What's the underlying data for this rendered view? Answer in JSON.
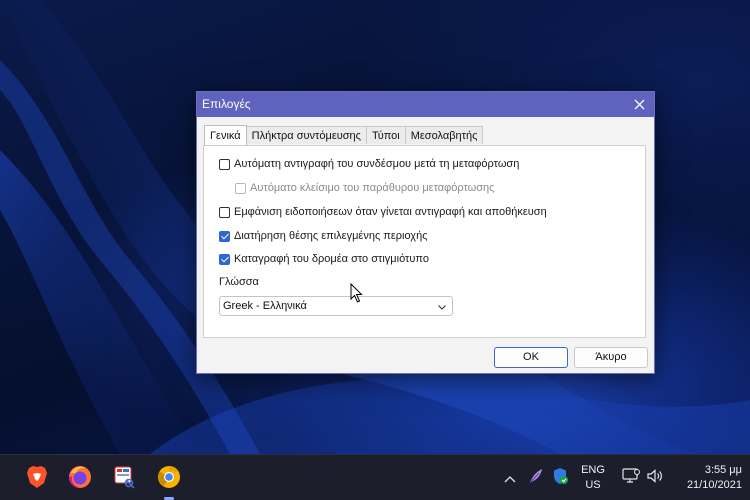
{
  "dialog": {
    "title": "Επιλογές",
    "tabs": [
      {
        "label": "Γενικά",
        "active": true
      },
      {
        "label": "Πλήκτρα συντόμευσης",
        "active": false
      },
      {
        "label": "Τύποι",
        "active": false
      },
      {
        "label": "Μεσολαβητής",
        "active": false
      }
    ],
    "options": [
      {
        "label": "Αυτόματη αντιγραφή του συνδέσμου μετά τη μεταφόρτωση",
        "checked": false,
        "enabled": true
      },
      {
        "label": "Αυτόματο κλείσιμο του παράθυρου μεταφόρτωσης",
        "checked": false,
        "enabled": false
      },
      {
        "label": "Εμφάνιση ειδοποιήσεων όταν γίνεται αντιγραφή και αποθήκευση",
        "checked": false,
        "enabled": true
      },
      {
        "label": "Διατήρηση θέσης επιλεγμένης περιοχής",
        "checked": true,
        "enabled": true
      },
      {
        "label": "Καταγραφή του δρομέα στο στιγμιότυπο",
        "checked": true,
        "enabled": true
      }
    ],
    "language_label": "Γλώσσα",
    "language_value": "Greek - Ελληνικά",
    "ok_label": "OK",
    "cancel_label": "Άκυρο"
  },
  "taskbar": {
    "apps": [
      "brave-icon",
      "firefox-icon",
      "snipping-app-icon",
      "chrome-canary-icon"
    ],
    "lang_top": "ENG",
    "lang_bottom": "US",
    "time": "3:55 μμ",
    "date": "21/10/2021"
  },
  "colors": {
    "titlebar": "#6063be",
    "accent": "#2f66d2",
    "taskbar": "#1c1f2b"
  }
}
